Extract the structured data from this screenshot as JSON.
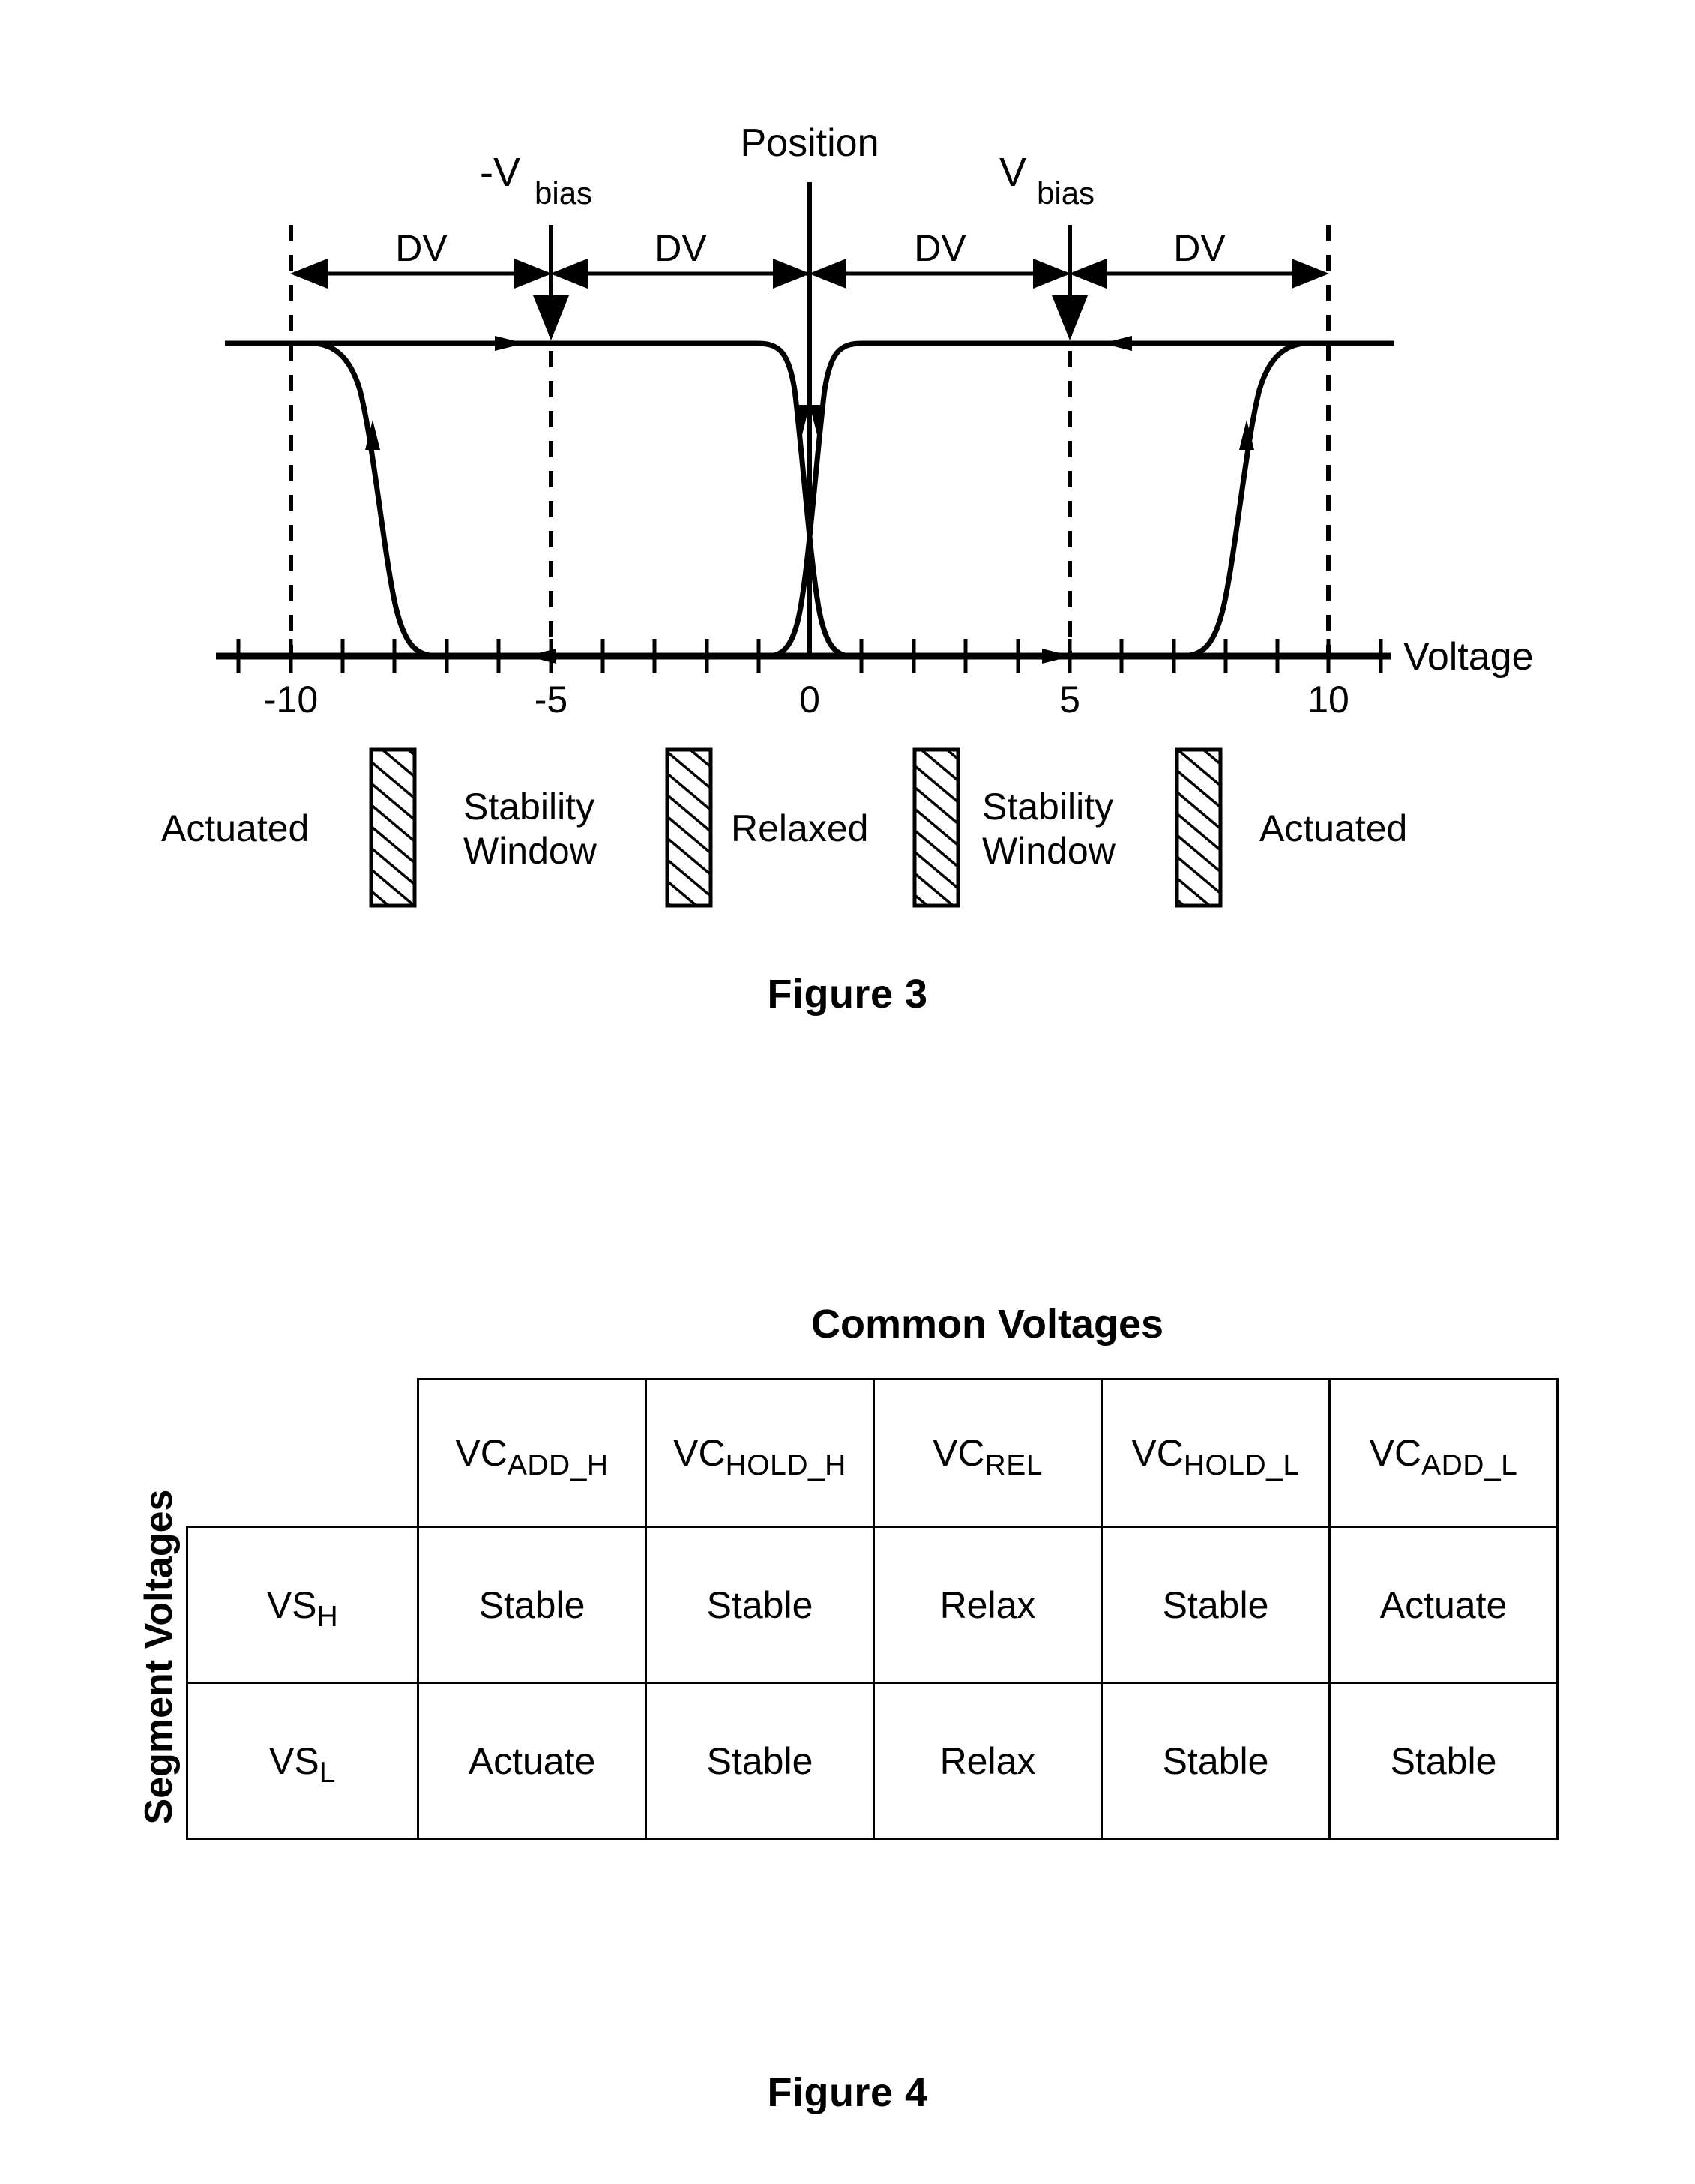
{
  "figure3": {
    "caption": "Figure 3",
    "axis": {
      "x_label": "Voltage",
      "y_label": "Position",
      "x_ticks": [
        "-10",
        "-5",
        "0",
        "5",
        "10"
      ],
      "x_tick_values": [
        -10,
        -5,
        0,
        5,
        10
      ],
      "x_min": -11.5,
      "x_max": 11.5,
      "tick_interval": 1
    },
    "bias_labels": {
      "negative": {
        "main": "-V",
        "sub": "bias",
        "value": -5
      },
      "positive": {
        "main": "V",
        "sub": "bias",
        "value": 5
      }
    },
    "dv_labels": [
      {
        "text": "DV",
        "from": -10,
        "to": -5
      },
      {
        "text": "DV",
        "from": -5,
        "to": 0
      },
      {
        "text": "DV",
        "from": 0,
        "to": 5
      },
      {
        "text": "DV",
        "from": 5,
        "to": 10
      }
    ],
    "legend": [
      {
        "text": "Actuated",
        "kind": "label"
      },
      {
        "text": "",
        "kind": "hatch-bar"
      },
      {
        "text": "Stability Window",
        "kind": "label",
        "line1": "Stability",
        "line2": "Window"
      },
      {
        "text": "",
        "kind": "hatch-bar"
      },
      {
        "text": "Relaxed",
        "kind": "label"
      },
      {
        "text": "",
        "kind": "hatch-bar"
      },
      {
        "text": "Stability Window",
        "kind": "label",
        "line1": "Stability",
        "line2": "Window"
      },
      {
        "text": "",
        "kind": "hatch-bar"
      },
      {
        "text": "Actuated",
        "kind": "label"
      }
    ]
  },
  "chart_data": {
    "type": "line",
    "title": "",
    "subtitle": "",
    "xlabel": "Voltage",
    "ylabel": "Position",
    "xlim": [
      -11.5,
      11.5
    ],
    "ylim": [
      0,
      1
    ],
    "grid": false,
    "legend_position": "below-axis",
    "x_tick_labels": [
      "-10",
      "-5",
      "0",
      "5",
      "10"
    ],
    "x_tick_values": [
      -10,
      -5,
      0,
      5,
      10
    ],
    "minor_tick_interval": 1,
    "annotations": [
      {
        "text": "-V",
        "sub": "bias",
        "x": -5
      },
      {
        "text": "V",
        "sub": "bias",
        "x": 5
      },
      {
        "text": "DV",
        "span": [
          -10,
          -5
        ]
      },
      {
        "text": "DV",
        "span": [
          -5,
          0
        ]
      },
      {
        "text": "DV",
        "span": [
          0,
          5
        ]
      },
      {
        "text": "DV",
        "span": [
          5,
          10
        ]
      }
    ],
    "series": [
      {
        "name": "negative-branch-actuated-to-relaxed",
        "description": "Upper (actuated) state held from -11 toward -2.3 then drops to relaxed",
        "direction": "left-to-right",
        "transition_x": -2.3,
        "high_value": 1,
        "low_value": 0
      },
      {
        "name": "negative-branch-relaxed-to-actuated",
        "description": "Lower (relaxed) state held from -2 leftward to -7.2 then rises to actuated",
        "direction": "right-to-left",
        "transition_x": -7.8,
        "high_value": 1,
        "low_value": 0
      },
      {
        "name": "positive-branch-relaxed-to-actuated",
        "description": "Lower (relaxed) state held from 2 rightward to 7.8 then rises to actuated",
        "direction": "left-to-right",
        "transition_x": 7.8,
        "high_value": 1,
        "low_value": 0
      },
      {
        "name": "positive-branch-actuated-to-relaxed",
        "description": "Upper (actuated) state held from 11 leftward to 2.3 then drops to relaxed",
        "direction": "right-to-left",
        "transition_x": 2.3,
        "high_value": 1,
        "low_value": 0
      }
    ],
    "regions": [
      {
        "label": "Actuated",
        "range": [
          -11.5,
          -9
        ]
      },
      {
        "label": "Stability Window",
        "range": [
          -8.5,
          -6
        ]
      },
      {
        "label": "Relaxed",
        "range": [
          -5.5,
          5.5
        ]
      },
      {
        "label": "Stability Window",
        "range": [
          6,
          8.5
        ]
      },
      {
        "label": "Actuated",
        "range": [
          9,
          11.5
        ]
      }
    ]
  },
  "figure4": {
    "caption": "Figure 4",
    "column_group_title": "Common Voltages",
    "row_group_title": "Segment Voltages",
    "columns": [
      {
        "main": "VC",
        "sub": "ADD_H"
      },
      {
        "main": "VC",
        "sub": "HOLD_H"
      },
      {
        "main": "VC",
        "sub": "REL"
      },
      {
        "main": "VC",
        "sub": "HOLD_L"
      },
      {
        "main": "VC",
        "sub": "ADD_L"
      }
    ],
    "rows": [
      {
        "label": {
          "main": "VS",
          "sub": "H"
        },
        "cells": [
          "Stable",
          "Stable",
          "Relax",
          "Stable",
          "Actuate"
        ]
      },
      {
        "label": {
          "main": "VS",
          "sub": "L"
        },
        "cells": [
          "Actuate",
          "Stable",
          "Relax",
          "Stable",
          "Stable"
        ]
      }
    ]
  },
  "colors": {
    "ink": "#000000",
    "background": "#ffffff"
  }
}
